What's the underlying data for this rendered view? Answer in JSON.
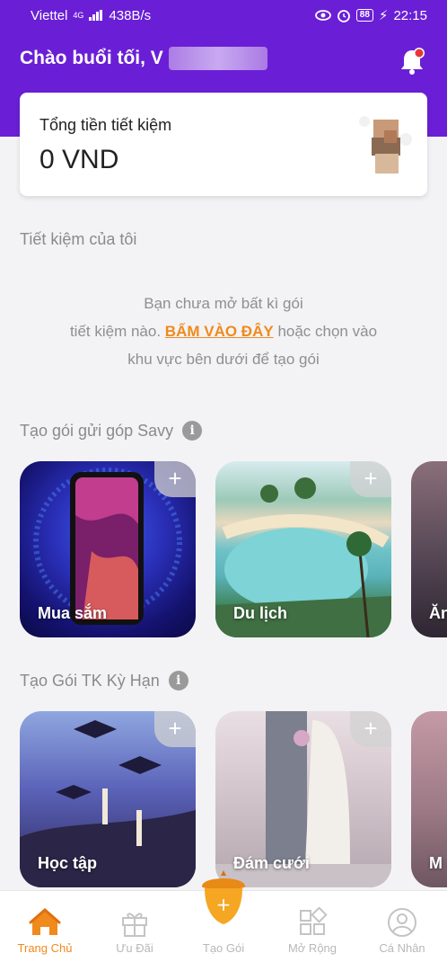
{
  "status_bar": {
    "carrier": "Viettel",
    "network": "4G",
    "speed": "438B/s",
    "battery": "88",
    "time": "22:15"
  },
  "header": {
    "greeting": "Chào buổi tối, V",
    "bell_icon": "bell-icon",
    "notification_color": "#e53935"
  },
  "savings": {
    "title": "Tổng tiền tiết kiệm",
    "amount": "0 VND"
  },
  "my_savings": {
    "title": "Tiết kiệm của tôi",
    "empty_line1": "Bạn chưa mở bất kì gói",
    "empty_line2_pre": "tiết kiệm nào.",
    "empty_cta": "BẤM VÀO ĐÂY",
    "empty_line2_post": "hoặc chọn vào",
    "empty_line3": "khu vực bên dưới để tạo gói"
  },
  "savy": {
    "title": "Tạo gói gửi góp Savy",
    "cards": [
      {
        "label": "Mua sắm",
        "plus": "+"
      },
      {
        "label": "Du lịch",
        "plus": "+"
      },
      {
        "label": "Ăn",
        "plus": "+"
      }
    ]
  },
  "term": {
    "title": "Tạo Gói TK Kỳ Hạn",
    "cards": [
      {
        "label": "Học tập",
        "plus": "+"
      },
      {
        "label": "Đám cưới",
        "plus": "+"
      },
      {
        "label": "M",
        "plus": "+"
      }
    ]
  },
  "bottom_nav": {
    "items": [
      {
        "label": "Trang Chủ",
        "icon": "home-icon",
        "active": true
      },
      {
        "label": "Ưu Đãi",
        "icon": "gift-icon",
        "active": false
      },
      {
        "label": "Tạo Gói",
        "icon": "acorn-plus-icon",
        "active": false
      },
      {
        "label": "Mở Rộng",
        "icon": "grid-icon",
        "active": false
      },
      {
        "label": "Cá Nhân",
        "icon": "profile-icon",
        "active": false
      }
    ],
    "fab_plus": "+"
  },
  "colors": {
    "header_purple": "#6a1fd6",
    "accent_orange": "#f08a1c"
  }
}
